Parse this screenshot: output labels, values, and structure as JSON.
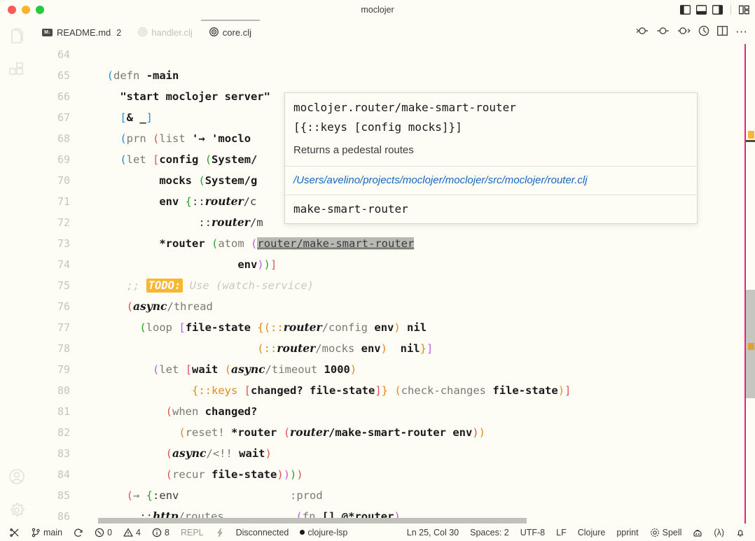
{
  "window": {
    "title": "moclojer",
    "traffic_lights": [
      "close",
      "minimize",
      "zoom"
    ],
    "layout_icons": [
      "toggle-primary-sidebar",
      "toggle-panel",
      "toggle-secondary-sidebar",
      "customize-layout"
    ]
  },
  "activity_bar": {
    "items": [
      {
        "name": "explorer",
        "icon": "files-icon"
      },
      {
        "name": "extensions",
        "icon": "extensions-icon"
      },
      {
        "name": "accounts",
        "icon": "account-icon"
      },
      {
        "name": "settings",
        "icon": "gear-icon"
      }
    ]
  },
  "tabs": [
    {
      "label": "README.md",
      "icon": "markdown-icon",
      "badge": "2",
      "state": "inactive"
    },
    {
      "label": "handler.clj",
      "icon": "clojure-icon",
      "badge": "",
      "state": "dimmed"
    },
    {
      "label": "core.clj",
      "icon": "clojure-icon",
      "badge": "",
      "state": "active"
    }
  ],
  "editor_actions": [
    {
      "name": "run-test-cursor",
      "icon": "test-cursor-icon"
    },
    {
      "name": "run-test",
      "icon": "test-icon"
    },
    {
      "name": "run-test-next",
      "icon": "test-next-icon"
    },
    {
      "name": "evaluate",
      "icon": "clock-icon"
    },
    {
      "name": "split-editor",
      "icon": "split-editor-icon"
    },
    {
      "name": "more-actions",
      "icon": "ellipsis-icon"
    }
  ],
  "code": {
    "first_line": 64,
    "lines": [
      {
        "n": "64",
        "tokens": []
      },
      {
        "n": "65",
        "tokens": [
          {
            "t": "  ",
            "c": "plain"
          },
          {
            "t": "(",
            "c": "p1"
          },
          {
            "t": "defn",
            "c": "sym"
          },
          {
            "t": " ",
            "c": "plain"
          },
          {
            "t": "-main",
            "c": "name"
          }
        ]
      },
      {
        "n": "66",
        "tokens": [
          {
            "t": "    ",
            "c": "plain"
          },
          {
            "t": "\"start moclojer server\"",
            "c": "str"
          }
        ]
      },
      {
        "n": "67",
        "tokens": [
          {
            "t": "    ",
            "c": "plain"
          },
          {
            "t": "[",
            "c": "p1"
          },
          {
            "t": "& _",
            "c": "name"
          },
          {
            "t": "]",
            "c": "p1"
          }
        ]
      },
      {
        "n": "68",
        "tokens": [
          {
            "t": "    ",
            "c": "plain"
          },
          {
            "t": "(",
            "c": "p1"
          },
          {
            "t": "prn",
            "c": "sym"
          },
          {
            "t": " ",
            "c": "plain"
          },
          {
            "t": "(",
            "c": "p0"
          },
          {
            "t": "list",
            "c": "sym"
          },
          {
            "t": " ",
            "c": "plain"
          },
          {
            "t": "'→",
            "c": "name"
          },
          {
            "t": " ",
            "c": "plain"
          },
          {
            "t": "'moclo",
            "c": "name"
          }
        ]
      },
      {
        "n": "69",
        "tokens": [
          {
            "t": "    ",
            "c": "plain"
          },
          {
            "t": "(",
            "c": "p1"
          },
          {
            "t": "let",
            "c": "sym"
          },
          {
            "t": " ",
            "c": "plain"
          },
          {
            "t": "[",
            "c": "p0"
          },
          {
            "t": "config",
            "c": "name"
          },
          {
            "t": " ",
            "c": "plain"
          },
          {
            "t": "(",
            "c": "p2"
          },
          {
            "t": "System/",
            "c": "name"
          }
        ]
      },
      {
        "n": "70",
        "tokens": [
          {
            "t": "          ",
            "c": "plain"
          },
          {
            "t": "mocks",
            "c": "name"
          },
          {
            "t": " ",
            "c": "plain"
          },
          {
            "t": "(",
            "c": "p2"
          },
          {
            "t": "System/g",
            "c": "name"
          }
        ]
      },
      {
        "n": "71",
        "tokens": [
          {
            "t": "          ",
            "c": "plain"
          },
          {
            "t": "env",
            "c": "name"
          },
          {
            "t": " ",
            "c": "plain"
          },
          {
            "t": "{",
            "c": "p2"
          },
          {
            "t": "::",
            "c": "kw2"
          },
          {
            "t": "router",
            "c": "ns"
          },
          {
            "t": "/c",
            "c": "kw2"
          }
        ]
      },
      {
        "n": "72",
        "tokens": [
          {
            "t": "                ",
            "c": "plain"
          },
          {
            "t": "::",
            "c": "kw2"
          },
          {
            "t": "router",
            "c": "ns"
          },
          {
            "t": "/m",
            "c": "kw2"
          }
        ]
      },
      {
        "n": "73",
        "tokens": [
          {
            "t": "          ",
            "c": "plain"
          },
          {
            "t": "*router",
            "c": "name"
          },
          {
            "t": " ",
            "c": "plain"
          },
          {
            "t": "(",
            "c": "p2"
          },
          {
            "t": "atom",
            "c": "sym"
          },
          {
            "t": " ",
            "c": "plain"
          },
          {
            "t": "(",
            "c": "p3"
          },
          {
            "t": "router/make-smart-router",
            "c": "sel"
          }
        ]
      },
      {
        "n": "74",
        "tokens": [
          {
            "t": "                      ",
            "c": "plain"
          },
          {
            "t": "env",
            "c": "name"
          },
          {
            "t": ")",
            "c": "p3"
          },
          {
            "t": ")",
            "c": "p2"
          },
          {
            "t": "]",
            "c": "p0"
          }
        ]
      },
      {
        "n": "75",
        "tokens": [
          {
            "t": "     ",
            "c": "plain"
          },
          {
            "t": ";; ",
            "c": "cmt"
          },
          {
            "t": "TODO:",
            "c": "todo"
          },
          {
            "t": " Use (watch-service)",
            "c": "cmt"
          }
        ]
      },
      {
        "n": "76",
        "tokens": [
          {
            "t": "     ",
            "c": "plain"
          },
          {
            "t": "(",
            "c": "p0"
          },
          {
            "t": "async",
            "c": "ns"
          },
          {
            "t": "/thread",
            "c": "sym"
          }
        ]
      },
      {
        "n": "77",
        "tokens": [
          {
            "t": "       ",
            "c": "plain"
          },
          {
            "t": "(",
            "c": "p2"
          },
          {
            "t": "loop",
            "c": "sym"
          },
          {
            "t": " ",
            "c": "plain"
          },
          {
            "t": "[",
            "c": "p3"
          },
          {
            "t": "file-state",
            "c": "name"
          },
          {
            "t": " ",
            "c": "plain"
          },
          {
            "t": "{",
            "c": "p4"
          },
          {
            "t": "(",
            "c": "p4"
          },
          {
            "t": "::",
            "c": "kw"
          },
          {
            "t": "router",
            "c": "ns"
          },
          {
            "t": "/config",
            "c": "sym"
          },
          {
            "t": " ",
            "c": "plain"
          },
          {
            "t": "env",
            "c": "name"
          },
          {
            "t": ")",
            "c": "p4"
          },
          {
            "t": " ",
            "c": "plain"
          },
          {
            "t": "nil",
            "c": "name"
          }
        ]
      },
      {
        "n": "78",
        "tokens": [
          {
            "t": "                         ",
            "c": "plain"
          },
          {
            "t": "(",
            "c": "p4"
          },
          {
            "t": "::",
            "c": "kw"
          },
          {
            "t": "router",
            "c": "ns"
          },
          {
            "t": "/mocks",
            "c": "sym"
          },
          {
            "t": " ",
            "c": "plain"
          },
          {
            "t": "env",
            "c": "name"
          },
          {
            "t": ")",
            "c": "p4"
          },
          {
            "t": "  ",
            "c": "plain"
          },
          {
            "t": "nil",
            "c": "name"
          },
          {
            "t": "}",
            "c": "p4"
          },
          {
            "t": "]",
            "c": "p3"
          }
        ]
      },
      {
        "n": "79",
        "tokens": [
          {
            "t": "         ",
            "c": "plain"
          },
          {
            "t": "(",
            "c": "p3"
          },
          {
            "t": "let",
            "c": "sym"
          },
          {
            "t": " ",
            "c": "plain"
          },
          {
            "t": "[",
            "c": "p0"
          },
          {
            "t": "wait",
            "c": "name"
          },
          {
            "t": " ",
            "c": "plain"
          },
          {
            "t": "(",
            "c": "p4"
          },
          {
            "t": "async",
            "c": "ns"
          },
          {
            "t": "/timeout",
            "c": "sym"
          },
          {
            "t": " ",
            "c": "plain"
          },
          {
            "t": "1000",
            "c": "num"
          },
          {
            "t": ")",
            "c": "p4"
          }
        ]
      },
      {
        "n": "80",
        "tokens": [
          {
            "t": "               ",
            "c": "plain"
          },
          {
            "t": "{",
            "c": "p4"
          },
          {
            "t": "::keys",
            "c": "kw"
          },
          {
            "t": " ",
            "c": "plain"
          },
          {
            "t": "[",
            "c": "p0"
          },
          {
            "t": "changed? file-state",
            "c": "name"
          },
          {
            "t": "]",
            "c": "p0"
          },
          {
            "t": "}",
            "c": "p4"
          },
          {
            "t": " ",
            "c": "plain"
          },
          {
            "t": "(",
            "c": "p4"
          },
          {
            "t": "check-changes",
            "c": "sym"
          },
          {
            "t": " ",
            "c": "plain"
          },
          {
            "t": "file-state",
            "c": "name"
          },
          {
            "t": ")",
            "c": "p4"
          },
          {
            "t": "]",
            "c": "p0"
          }
        ]
      },
      {
        "n": "81",
        "tokens": [
          {
            "t": "           ",
            "c": "plain"
          },
          {
            "t": "(",
            "c": "p0"
          },
          {
            "t": "when",
            "c": "sym"
          },
          {
            "t": " ",
            "c": "plain"
          },
          {
            "t": "changed?",
            "c": "name"
          }
        ]
      },
      {
        "n": "82",
        "tokens": [
          {
            "t": "             ",
            "c": "plain"
          },
          {
            "t": "(",
            "c": "p4"
          },
          {
            "t": "reset!",
            "c": "sym"
          },
          {
            "t": " ",
            "c": "plain"
          },
          {
            "t": "*router",
            "c": "name"
          },
          {
            "t": " ",
            "c": "plain"
          },
          {
            "t": "(",
            "c": "p0"
          },
          {
            "t": "router",
            "c": "ns"
          },
          {
            "t": "/make-smart-router",
            "c": "name"
          },
          {
            "t": " ",
            "c": "plain"
          },
          {
            "t": "env",
            "c": "name"
          },
          {
            "t": ")",
            "c": "p0"
          },
          {
            "t": ")",
            "c": "p4"
          }
        ]
      },
      {
        "n": "83",
        "tokens": [
          {
            "t": "           ",
            "c": "plain"
          },
          {
            "t": "(",
            "c": "p0"
          },
          {
            "t": "async",
            "c": "ns"
          },
          {
            "t": "/<!!",
            "c": "sym"
          },
          {
            "t": " ",
            "c": "plain"
          },
          {
            "t": "wait",
            "c": "name"
          },
          {
            "t": ")",
            "c": "p0"
          }
        ]
      },
      {
        "n": "84",
        "tokens": [
          {
            "t": "           ",
            "c": "plain"
          },
          {
            "t": "(",
            "c": "p0"
          },
          {
            "t": "recur",
            "c": "sym"
          },
          {
            "t": " ",
            "c": "plain"
          },
          {
            "t": "file-state",
            "c": "name"
          },
          {
            "t": ")",
            "c": "p0"
          },
          {
            "t": ")",
            "c": "p3"
          },
          {
            "t": ")",
            "c": "p2"
          },
          {
            "t": ")",
            "c": "p0"
          }
        ]
      },
      {
        "n": "85",
        "tokens": [
          {
            "t": "     ",
            "c": "plain"
          },
          {
            "t": "(",
            "c": "p0"
          },
          {
            "t": "→",
            "c": "sym"
          },
          {
            "t": " ",
            "c": "plain"
          },
          {
            "t": "{",
            "c": "p2"
          },
          {
            "t": ":env",
            "c": "kw2"
          },
          {
            "t": "                 ",
            "c": "plain"
          },
          {
            "t": ":prod",
            "c": "sym"
          }
        ]
      },
      {
        "n": "86",
        "tokens": [
          {
            "t": "       ",
            "c": "plain"
          },
          {
            "t": "::",
            "c": "kw2"
          },
          {
            "t": "http",
            "c": "ns"
          },
          {
            "t": "/routes",
            "c": "sym"
          },
          {
            "t": "           ",
            "c": "plain"
          },
          {
            "t": "(",
            "c": "p3"
          },
          {
            "t": "fn",
            "c": "sym"
          },
          {
            "t": " ",
            "c": "plain"
          },
          {
            "t": "[]",
            "c": "name"
          },
          {
            "t": " ",
            "c": "plain"
          },
          {
            "t": "@*router",
            "c": "name"
          },
          {
            "t": ")",
            "c": "p3"
          }
        ]
      }
    ],
    "trailing_right_parens": [
      {
        "t": ")",
        "c": "p0"
      },
      {
        "t": ")",
        "c": "p1"
      }
    ]
  },
  "hover_popup": {
    "signature_ns": "moclojer.router/make-smart-router",
    "signature_args": "[{::keys [config mocks]}]",
    "doc": "Returns a pedestal routes",
    "file_path": "/Users/avelino/projects/moclojer/moclojer/src/moclojer/router.clj",
    "symbol_name": "make-smart-router",
    "link_color": "#1565c0"
  },
  "status_bar": {
    "left": [
      {
        "name": "remote-host",
        "icon": "remote-icon",
        "label": ""
      },
      {
        "name": "source-control-branch",
        "icon": "branch-icon",
        "label": "main"
      },
      {
        "name": "sync-changes",
        "icon": "sync-icon",
        "label": ""
      },
      {
        "name": "errors-count",
        "icon": "error-icon",
        "label": "0"
      },
      {
        "name": "warnings-count",
        "icon": "warning-icon",
        "label": "4"
      },
      {
        "name": "info-count",
        "icon": "info-icon",
        "label": "8"
      },
      {
        "name": "repl",
        "icon": "",
        "label": "REPL",
        "dim": true
      },
      {
        "name": "repl-connect",
        "icon": "flash-icon",
        "label": "",
        "dim": true
      },
      {
        "name": "repl-status",
        "icon": "",
        "label": "Disconnected",
        "dim": false
      },
      {
        "name": "language-server",
        "icon": "dot-icon",
        "label": "clojure-lsp"
      }
    ],
    "right": [
      {
        "name": "cursor-position",
        "icon": "",
        "label": "Ln 25, Col 30"
      },
      {
        "name": "indentation",
        "icon": "",
        "label": "Spaces: 2"
      },
      {
        "name": "encoding",
        "icon": "",
        "label": "UTF-8"
      },
      {
        "name": "end-of-line",
        "icon": "",
        "label": "LF"
      },
      {
        "name": "language-mode",
        "icon": "",
        "label": "Clojure"
      },
      {
        "name": "formatter",
        "icon": "",
        "label": "pprint"
      },
      {
        "name": "spell-checker",
        "icon": "spell-icon",
        "label": "Spell"
      },
      {
        "name": "copilot",
        "icon": "copilot-icon",
        "label": ""
      },
      {
        "name": "calva-lambda",
        "icon": "",
        "label": "(λ)"
      },
      {
        "name": "notifications",
        "icon": "bell-icon",
        "label": ""
      }
    ]
  },
  "colors": {
    "background": "#fdfdf6",
    "accent_magenta": "#ec1e79",
    "todo_highlight": "#f7b731",
    "link_blue": "#1565c0",
    "selection_gray": "#b9b9b4"
  }
}
